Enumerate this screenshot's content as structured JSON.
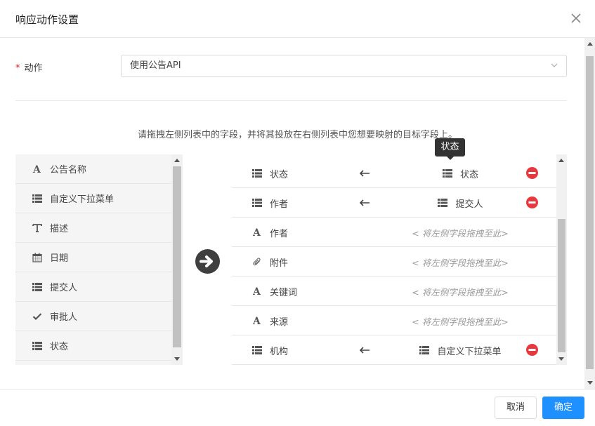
{
  "dialog": {
    "title": "响应动作设置"
  },
  "form": {
    "action_label": "动作",
    "required_mark": "*",
    "action_value": "使用公告API"
  },
  "instruction": "请拖拽左侧列表中的字段，并将其投放在右侧列表中您想要映射的目标字段上。",
  "left_fields": [
    {
      "label": "公告名称",
      "icon": "text-a-icon"
    },
    {
      "label": "自定义下拉菜单",
      "icon": "list-icon"
    },
    {
      "label": "描述",
      "icon": "text-t-icon"
    },
    {
      "label": "日期",
      "icon": "calendar-icon"
    },
    {
      "label": "提交人",
      "icon": "list-icon"
    },
    {
      "label": "审批人",
      "icon": "check-icon"
    },
    {
      "label": "状态",
      "icon": "list-icon"
    }
  ],
  "right_fields": [
    {
      "label": "状态",
      "icon": "list-icon",
      "mapped": "状态",
      "mapped_icon": "list-icon"
    },
    {
      "label": "作者",
      "icon": "list-icon",
      "mapped": "提交人",
      "mapped_icon": "list-icon"
    },
    {
      "label": "作者",
      "icon": "text-a-icon",
      "placeholder": "< 将左侧字段拖拽至此>"
    },
    {
      "label": "附件",
      "icon": "paperclip-icon",
      "placeholder": "< 将左侧字段拖拽至此>"
    },
    {
      "label": "关键词",
      "icon": "text-a-icon",
      "placeholder": "< 将左侧字段拖拽至此>"
    },
    {
      "label": "来源",
      "icon": "text-a-icon",
      "placeholder": "< 将左侧字段拖拽至此>"
    },
    {
      "label": "机构",
      "icon": "list-icon",
      "mapped": "自定义下拉菜单",
      "mapped_icon": "list-icon"
    }
  ],
  "tooltip": "状态",
  "buttons": {
    "cancel": "取消",
    "ok": "确定"
  },
  "colors": {
    "primary": "#1e90ff",
    "remove": "#e8383d",
    "required": "#e02020"
  }
}
